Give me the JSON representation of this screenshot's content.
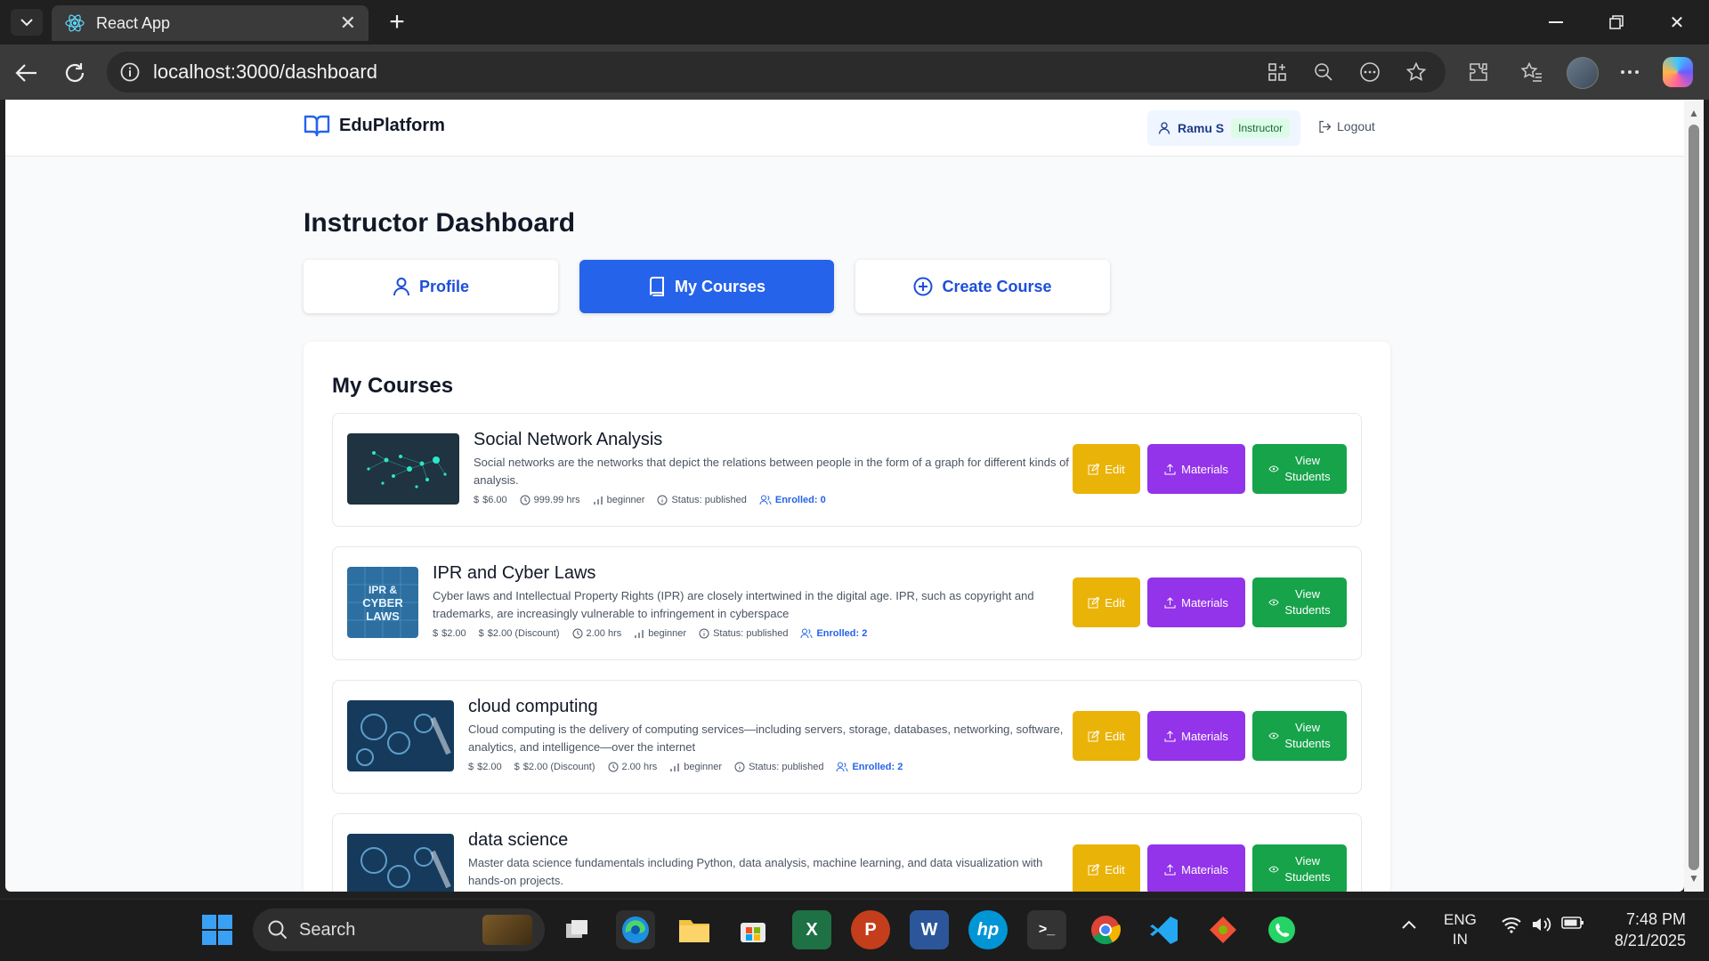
{
  "browser": {
    "tab_title": "React App",
    "url": "localhost:3000/dashboard"
  },
  "header": {
    "brand": "EduPlatform",
    "user_name": "Ramu S",
    "role": "Instructor",
    "logout": "Logout"
  },
  "dashboard": {
    "title": "Instructor Dashboard",
    "tabs": [
      {
        "label": "Profile",
        "active": false
      },
      {
        "label": "My Courses",
        "active": true
      },
      {
        "label": "Create Course",
        "active": false
      }
    ]
  },
  "courses_section": {
    "title": "My Courses",
    "actions": {
      "edit": "Edit",
      "materials": "Materials",
      "view_line1": "View",
      "view_line2": "Students"
    },
    "courses": [
      {
        "title": "Social Network Analysis",
        "description": "Social networks are the networks that depict the relations between people in the form of a graph for different kinds of analysis.",
        "price": "$6.00",
        "duration": "999.99 hrs",
        "level": "beginner",
        "status": "Status: published",
        "enrolled": "Enrolled: 0"
      },
      {
        "title": "IPR and Cyber Laws",
        "description": "Cyber laws and Intellectual Property Rights (IPR) are closely intertwined in the digital age. IPR, such as copyright and trademarks, are increasingly vulnerable to infringement in cyberspace",
        "price": "$2.00",
        "discount": "$2.00 (Discount)",
        "duration": "2.00 hrs",
        "level": "beginner",
        "status": "Status: published",
        "enrolled": "Enrolled: 2",
        "thumb_text": [
          "IPR &",
          "CYBER",
          "LAWS"
        ]
      },
      {
        "title": "cloud computing",
        "description": "Cloud computing is the delivery of computing services—including servers, storage, databases, networking, software, analytics, and intelligence—over the internet",
        "price": "$2.00",
        "discount": "$2.00 (Discount)",
        "duration": "2.00 hrs",
        "level": "beginner",
        "status": "Status: published",
        "enrolled": "Enrolled: 2"
      },
      {
        "title": "data science",
        "description": "Master data science fundamentals including Python, data analysis, machine learning, and data visualization with hands-on projects."
      }
    ]
  },
  "taskbar": {
    "search": "Search",
    "lang_line1": "ENG",
    "lang_line2": "IN",
    "time": "7:48 PM",
    "date": "8/21/2025"
  },
  "colors": {
    "primary": "#2563eb",
    "edit": "#eab308",
    "materials": "#9333ea",
    "view": "#16a34a"
  }
}
